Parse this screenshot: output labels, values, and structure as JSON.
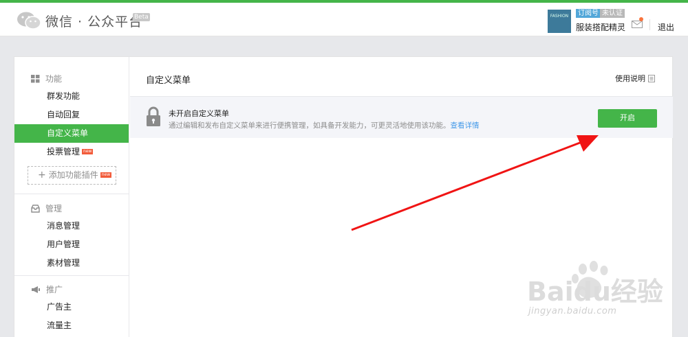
{
  "header": {
    "logo_text": "微信 · 公众平台",
    "beta": "Beta",
    "avatar_text": "FASHION",
    "tag_subscription": "订阅号",
    "tag_unverified": "未认证",
    "account_name": "服装搭配精灵",
    "logout": "退出"
  },
  "sidebar": {
    "sections": [
      {
        "title": "功能",
        "icon": "grid-icon"
      },
      {
        "title": "管理",
        "icon": "inbox-icon"
      },
      {
        "title": "推广",
        "icon": "megaphone-icon"
      }
    ],
    "items": [
      {
        "label": "群发功能"
      },
      {
        "label": "自动回复"
      },
      {
        "label": "自定义菜单",
        "active": true
      },
      {
        "label": "投票管理",
        "badge": "new"
      },
      {
        "label": "消息管理"
      },
      {
        "label": "用户管理"
      },
      {
        "label": "素材管理"
      },
      {
        "label": "广告主"
      },
      {
        "label": "流量主"
      }
    ],
    "add_plugin": {
      "label": "添加功能插件",
      "badge": "new"
    }
  },
  "main": {
    "title": "自定义菜单",
    "help": "使用说明",
    "notice": {
      "title": "未开启自定义菜单",
      "desc": "通过编辑和发布自定义菜单来进行便携管理，如具备开发能力，可更灵活地使用该功能。",
      "link": "查看详情"
    },
    "open_button": "开启"
  },
  "colors": {
    "accent": "#44b549",
    "link": "#459ae9",
    "arrow": "#f01414"
  },
  "watermark": {
    "brand": "Baidu经验",
    "url": "jingyan.baidu.com"
  }
}
